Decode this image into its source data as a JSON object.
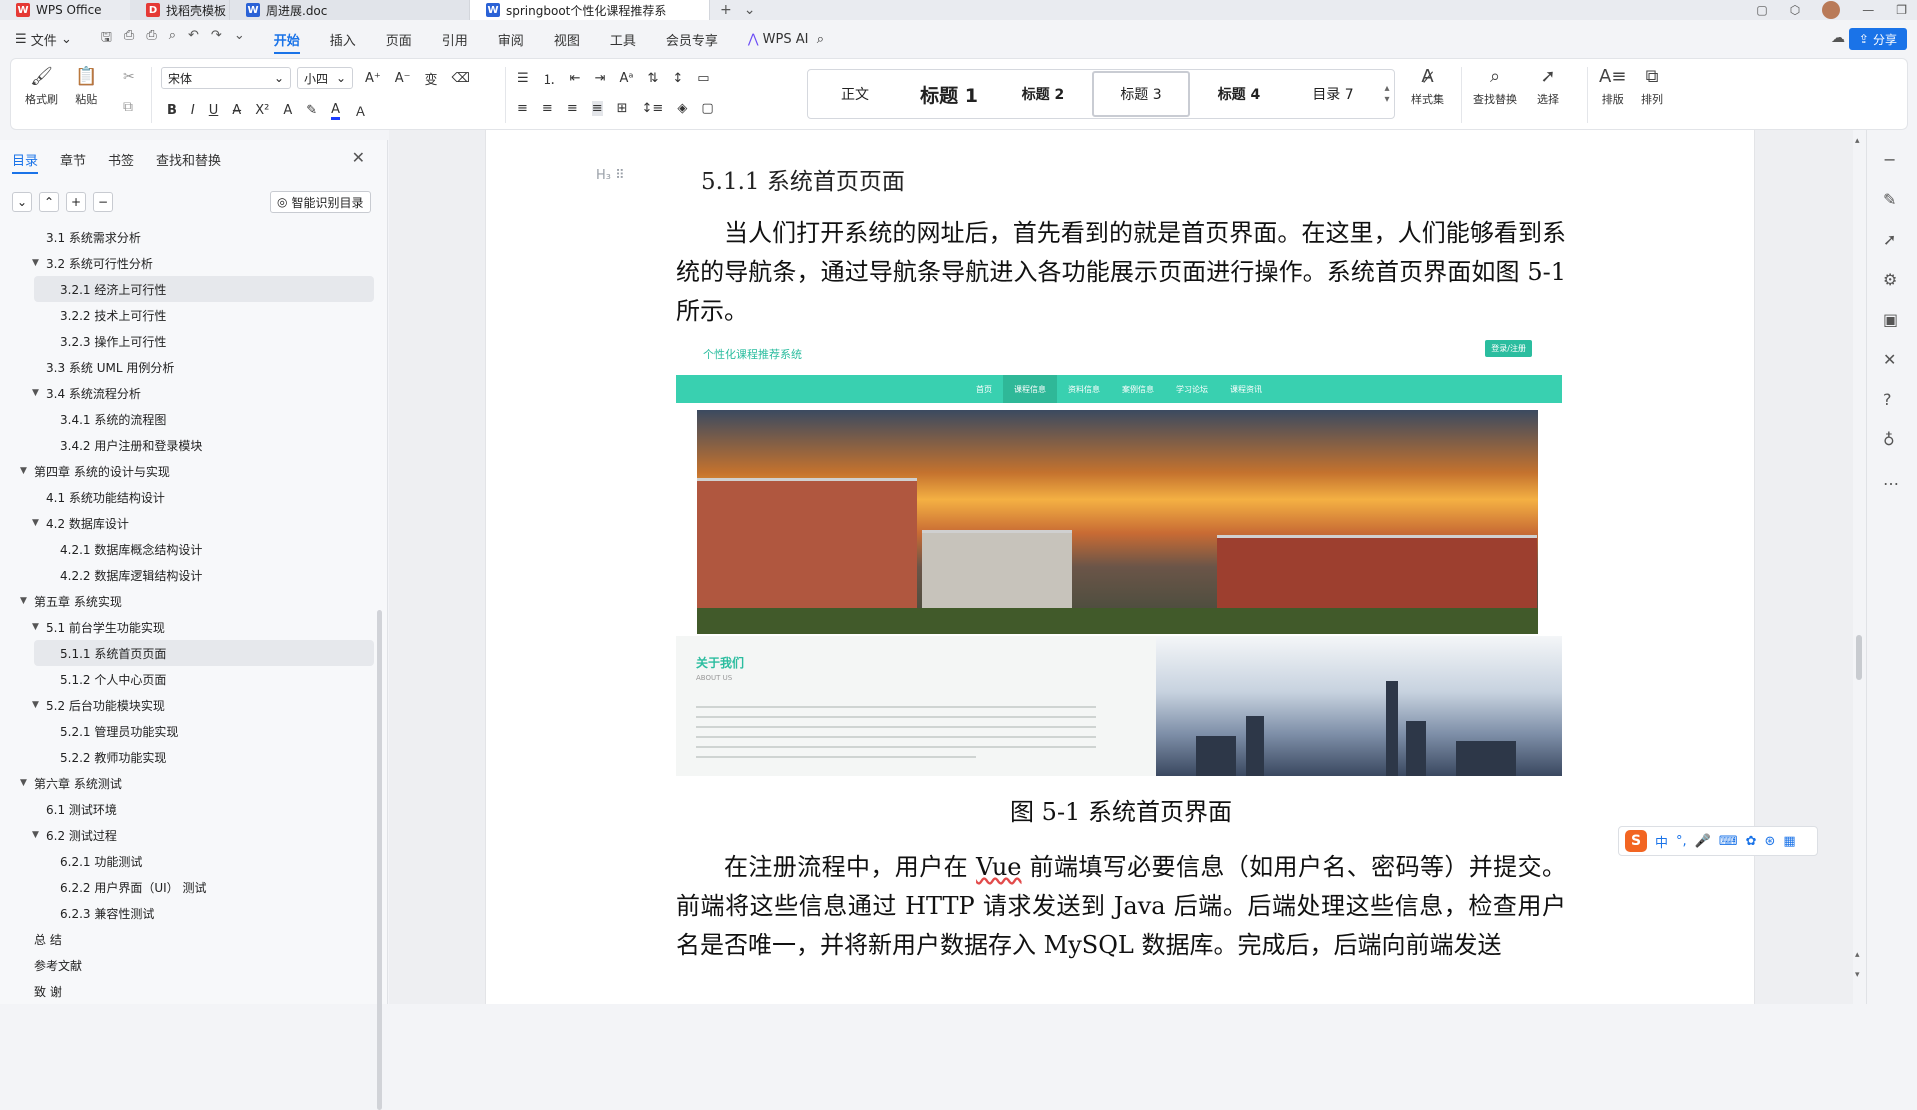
{
  "tabs": [
    {
      "label": "WPS Office",
      "logo": "W",
      "color": "#e53935"
    },
    {
      "label": "找稻壳模板",
      "logo": "D",
      "color": "#e53935"
    },
    {
      "label": "周进展.doc",
      "logo": "W",
      "color": "#2b62d6"
    },
    {
      "label": "springboot个性化课程推荐系",
      "logo": "W",
      "color": "#2b62d6"
    }
  ],
  "menu": {
    "file": "文件",
    "items": [
      "开始",
      "插入",
      "页面",
      "引用",
      "审阅",
      "视图",
      "工具",
      "会员专享"
    ],
    "active": "开始",
    "wps_ai": "WPS AI",
    "share": "分享"
  },
  "ribbon": {
    "format_painter": "格式刷",
    "paste": "粘贴",
    "font": "宋体",
    "size": "小四",
    "styles": [
      "正文",
      "标题 1",
      "标题 2",
      "标题 3",
      "标题 4",
      "目录 7"
    ],
    "style_set": "样式集",
    "find_replace": "查找替换",
    "select": "选择",
    "layout": "排版",
    "arrange": "排列"
  },
  "sidepanel": {
    "tabs": [
      "目录",
      "章节",
      "书签",
      "查找和替换"
    ],
    "smart_toc": "智能识别目录",
    "toc": [
      {
        "label": "3.1 系统需求分析",
        "level": 2,
        "arrow": ""
      },
      {
        "label": "3.2 系统可行性分析",
        "level": 2,
        "arrow": "▼"
      },
      {
        "label": "3.2.1 经济上可行性",
        "level": 3,
        "arrow": "",
        "hl": true
      },
      {
        "label": "3.2.2 技术上可行性",
        "level": 3,
        "arrow": ""
      },
      {
        "label": "3.2.3 操作上可行性",
        "level": 3,
        "arrow": ""
      },
      {
        "label": "3.3 系统 UML 用例分析",
        "level": 2,
        "arrow": ""
      },
      {
        "label": "3.4 系统流程分析",
        "level": 2,
        "arrow": "▼"
      },
      {
        "label": "3.4.1 系统的流程图",
        "level": 3,
        "arrow": ""
      },
      {
        "label": "3.4.2 用户注册和登录模块",
        "level": 3,
        "arrow": ""
      },
      {
        "label": "第四章 系统的设计与实现",
        "level": 1,
        "arrow": "▼"
      },
      {
        "label": "4.1 系统功能结构设计",
        "level": 2,
        "arrow": ""
      },
      {
        "label": "4.2 数据库设计",
        "level": 2,
        "arrow": "▼"
      },
      {
        "label": "4.2.1 数据库概念结构设计",
        "level": 3,
        "arrow": ""
      },
      {
        "label": "4.2.2 数据库逻辑结构设计",
        "level": 3,
        "arrow": ""
      },
      {
        "label": "第五章 系统实现",
        "level": 1,
        "arrow": "▼"
      },
      {
        "label": "5.1 前台学生功能实现",
        "level": 2,
        "arrow": "▼"
      },
      {
        "label": "5.1.1 系统首页页面",
        "level": 3,
        "arrow": "",
        "hl": true
      },
      {
        "label": "5.1.2 个人中心页面",
        "level": 3,
        "arrow": ""
      },
      {
        "label": "5.2 后台功能模块实现",
        "level": 2,
        "arrow": "▼"
      },
      {
        "label": "5.2.1 管理员功能实现",
        "level": 3,
        "arrow": ""
      },
      {
        "label": "5.2.2 教师功能实现",
        "level": 3,
        "arrow": ""
      },
      {
        "label": "第六章 系统测试",
        "level": 1,
        "arrow": "▼"
      },
      {
        "label": "6.1 测试环境",
        "level": 2,
        "arrow": ""
      },
      {
        "label": "6.2 测试过程",
        "level": 2,
        "arrow": "▼"
      },
      {
        "label": "6.2.1 功能测试",
        "level": 3,
        "arrow": ""
      },
      {
        "label": "6.2.2 用户界面（UI） 测试",
        "level": 3,
        "arrow": ""
      },
      {
        "label": "6.2.3 兼容性测试",
        "level": 3,
        "arrow": ""
      },
      {
        "label": "总 结",
        "level": 1,
        "arrow": ""
      },
      {
        "label": "参考文献",
        "level": 1,
        "arrow": ""
      },
      {
        "label": "致 谢",
        "level": 1,
        "arrow": ""
      }
    ]
  },
  "doc": {
    "heading_marker": "H₃ ⠿",
    "heading": "5.1.1 系统首页页面",
    "para1": "当人们打开系统的网址后，首先看到的就是首页界面。在这里，人们能够看到系统的导航条，通过导航条导航进入各功能展示页面进行操作。系统首页界面如图 5-1 所示。",
    "figure": {
      "site_title": "个性化课程推荐系统",
      "login": "登录/注册",
      "nav": [
        "首页",
        "课程信息",
        "资料信息",
        "案例信息",
        "学习论坛",
        "课程资讯"
      ],
      "about_title": "关于我们",
      "about_sub": "ABOUT US"
    },
    "caption": "图 5-1 系统首页界面",
    "para2_a": "在注册流程中，用户在 ",
    "para2_vue": "Vue",
    "para2_b": " 前端填写必要信息（如用户名、密码等）并提交。前端将这些信息通过 HTTP 请求发送到 Java 后端。后端处理这些信息，检查用户名是否唯一，并将新用户数据存入 MySQL 数据库。完成后，后端向前端发送"
  },
  "ime": {
    "logo": "S",
    "mode": "中"
  }
}
